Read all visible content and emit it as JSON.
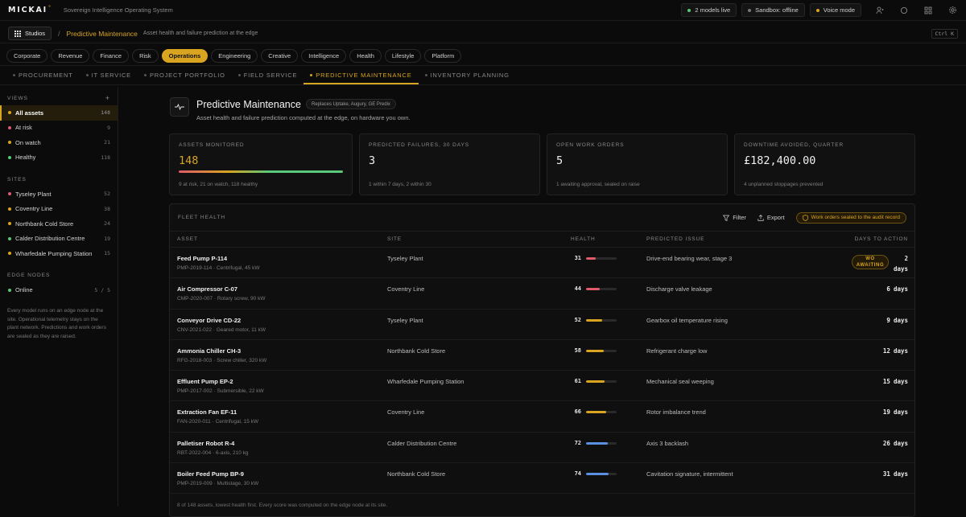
{
  "topbar": {
    "brand": "MICKAI",
    "brand_mark": "°",
    "subtitle": "Sovereign Intelligence Operating System",
    "models_live": "2 models live",
    "sandbox": "Sandbox: offline",
    "voice": "Voice mode",
    "icons": [
      "user-icon",
      "circle-icon",
      "grid-icon",
      "gear-icon"
    ]
  },
  "breadcrumb": {
    "studios": "Studios",
    "separator": "/",
    "title": "Predictive Maintenance",
    "description": "Asset health and failure prediction at the edge",
    "shortcut": "Ctrl K"
  },
  "categories": [
    "Corporate",
    "Revenue",
    "Finance",
    "Risk",
    "Operations",
    "Engineering",
    "Creative",
    "Intelligence",
    "Health",
    "Lifestyle",
    "Platform"
  ],
  "active_category": "Operations",
  "subtabs": [
    "PROCUREMENT",
    "IT SERVICE",
    "PROJECT PORTFOLIO",
    "FIELD SERVICE",
    "PREDICTIVE MAINTENANCE",
    "INVENTORY PLANNING"
  ],
  "active_subtab": "PREDICTIVE MAINTENANCE",
  "sidebar": {
    "views_label": "VIEWS",
    "views_add": "+",
    "views": [
      {
        "label": "All assets",
        "count": "148",
        "color": "#d9a520"
      },
      {
        "label": "At risk",
        "count": "9",
        "color": "#e05a6a"
      },
      {
        "label": "On watch",
        "count": "21",
        "color": "#d9a520"
      },
      {
        "label": "Healthy",
        "count": "118",
        "color": "#5ac878"
      }
    ],
    "sites_label": "SITES",
    "sites": [
      {
        "label": "Tyseley Plant",
        "count": "52",
        "color": "#e05a6a"
      },
      {
        "label": "Coventry Line",
        "count": "38",
        "color": "#d9a520"
      },
      {
        "label": "Northbank Cold Store",
        "count": "24",
        "color": "#d9a520"
      },
      {
        "label": "Calder Distribution Centre",
        "count": "19",
        "color": "#5ac878"
      },
      {
        "label": "Wharfedale Pumping Station",
        "count": "15",
        "color": "#d9a520"
      }
    ],
    "edge_label": "EDGE NODES",
    "edge": {
      "label": "Online",
      "count": "5 / 5",
      "color": "#5ac878"
    },
    "note": "Every model runs on an edge node at the site. Operational telemetry stays on the plant network. Predictions and work orders are sealed as they are raised."
  },
  "hero": {
    "title": "Predictive Maintenance",
    "badge": "Replaces Uptake, Augury, GE Predix",
    "description": "Asset health and failure prediction computed at the edge, on hardware you own."
  },
  "kpis": [
    {
      "label": "ASSETS MONITORED",
      "value": "148",
      "sub": "9 at risk, 21 on watch, 118 healthy"
    },
    {
      "label": "PREDICTED FAILURES, 30 DAYS",
      "value": "3",
      "sub": "1 within 7 days, 2 within 30"
    },
    {
      "label": "OPEN WORK ORDERS",
      "value": "5",
      "sub": "1 awaiting approval, sealed on raise"
    },
    {
      "label": "DOWNTIME AVOIDED, QUARTER",
      "value": "£182,400.00",
      "sub": "4 unplanned stoppages prevented"
    }
  ],
  "fleet": {
    "title": "FLEET HEALTH",
    "filter": "Filter",
    "export": "Export",
    "sealed": "Work orders sealed to the audit record",
    "columns": [
      "ASSET",
      "SITE",
      "HEALTH",
      "PREDICTED ISSUE",
      "DAYS TO ACTION"
    ],
    "wo_line1": "WO",
    "wo_line2": "AWAITING",
    "rows": [
      {
        "name": "Feed Pump P-114",
        "sub": "PMP-2019-114 · Centrifugal, 45 kW",
        "site": "Tyseley Plant",
        "health": 31,
        "issue": "Drive-end bearing wear, stage 3",
        "days": "2",
        "unit": "days",
        "color": "#e05a6a",
        "wo": true
      },
      {
        "name": "Air Compressor C-07",
        "sub": "CMP-2020-007 · Rotary screw, 90 kW",
        "site": "Coventry Line",
        "health": 44,
        "issue": "Discharge valve leakage",
        "days": "6",
        "unit": "days",
        "color": "#e05a6a",
        "wo": false
      },
      {
        "name": "Conveyor Drive CD-22",
        "sub": "CNV-2021-022 · Geared motor, 11 kW",
        "site": "Tyseley Plant",
        "health": 52,
        "issue": "Gearbox oil temperature rising",
        "days": "9",
        "unit": "days",
        "color": "#d9a520",
        "wo": false
      },
      {
        "name": "Ammonia Chiller CH-3",
        "sub": "RFG-2018-003 · Screw chiller, 320 kW",
        "site": "Northbank Cold Store",
        "health": 58,
        "issue": "Refrigerant charge low",
        "days": "12",
        "unit": "days",
        "color": "#d9a520",
        "wo": false
      },
      {
        "name": "Effluent Pump EP-2",
        "sub": "PMP-2017-002 · Submersible, 22 kW",
        "site": "Wharfedale Pumping Station",
        "health": 61,
        "issue": "Mechanical seal weeping",
        "days": "15",
        "unit": "days",
        "color": "#d9a520",
        "wo": false
      },
      {
        "name": "Extraction Fan EF-11",
        "sub": "FAN-2020-011 · Centrifugal, 15 kW",
        "site": "Coventry Line",
        "health": 66,
        "issue": "Rotor imbalance trend",
        "days": "19",
        "unit": "days",
        "color": "#d9a520",
        "wo": false
      },
      {
        "name": "Palletiser Robot R-4",
        "sub": "RBT-2022-004 · 6-axis, 210 kg",
        "site": "Calder Distribution Centre",
        "health": 72,
        "issue": "Axis 3 backlash",
        "days": "26",
        "unit": "days",
        "color": "#5b8fe0",
        "wo": false
      },
      {
        "name": "Boiler Feed Pump BP-9",
        "sub": "PMP-2019-009 · Multistage, 30 kW",
        "site": "Northbank Cold Store",
        "health": 74,
        "issue": "Cavitation signature, intermittent",
        "days": "31",
        "unit": "days",
        "color": "#5b8fe0",
        "wo": false
      }
    ],
    "footer": "8 of 148 assets, lowest health first. Every score was computed on the edge node at its site."
  }
}
